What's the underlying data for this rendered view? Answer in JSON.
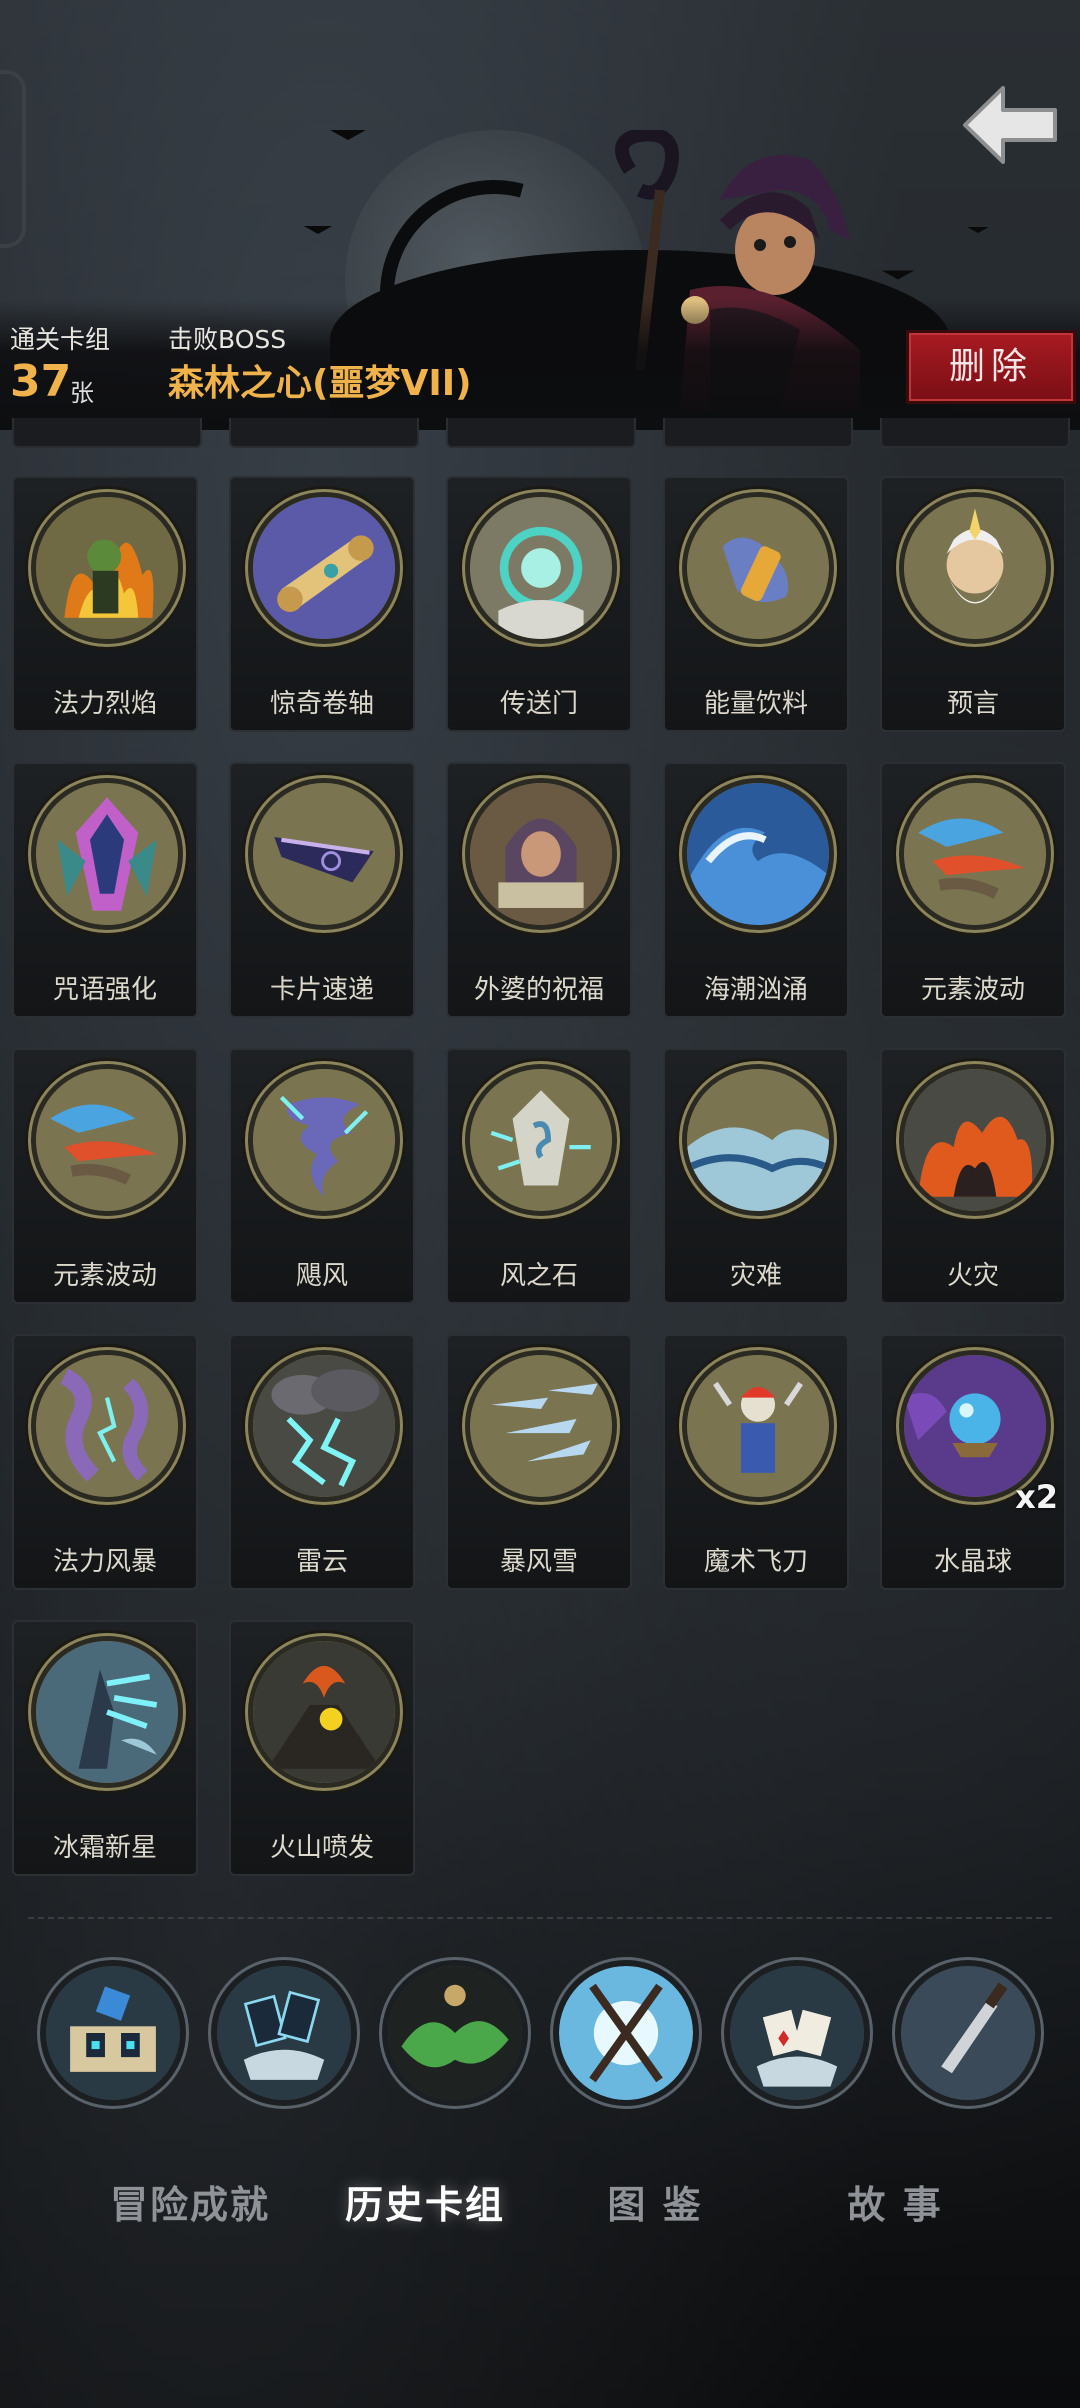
{
  "header": {
    "cleared_label": "通关卡组",
    "cleared_count": "37",
    "cleared_unit": "张",
    "boss_label": "击败BOSS",
    "boss_name": "森林之心(噩梦VII)",
    "delete_label": "删除"
  },
  "colors": {
    "accent_gold": "#f0b24a",
    "delete_red": "#a81a22",
    "card_bg": "#1a1c1f"
  },
  "cards": [
    {
      "name": "法力烈焰",
      "icon": "mana-flame-icon"
    },
    {
      "name": "惊奇卷轴",
      "icon": "scroll-icon"
    },
    {
      "name": "传送门",
      "icon": "portal-icon"
    },
    {
      "name": "能量饮料",
      "icon": "energy-drink-icon"
    },
    {
      "name": "预言",
      "icon": "prophecy-icon"
    },
    {
      "name": "咒语强化",
      "icon": "spell-boost-icon"
    },
    {
      "name": "卡片速递",
      "icon": "card-delivery-icon"
    },
    {
      "name": "外婆的祝福",
      "icon": "grandma-blessing-icon"
    },
    {
      "name": "海潮汹涌",
      "icon": "tide-icon"
    },
    {
      "name": "元素波动",
      "icon": "elemental-wave-icon"
    },
    {
      "name": "元素波动",
      "icon": "elemental-wave-icon"
    },
    {
      "name": "飓风",
      "icon": "hurricane-icon"
    },
    {
      "name": "风之石",
      "icon": "wind-stone-icon"
    },
    {
      "name": "灾难",
      "icon": "disaster-icon"
    },
    {
      "name": "火灾",
      "icon": "fire-icon"
    },
    {
      "name": "法力风暴",
      "icon": "mana-storm-icon"
    },
    {
      "name": "雷云",
      "icon": "thundercloud-icon"
    },
    {
      "name": "暴风雪",
      "icon": "blizzard-icon"
    },
    {
      "name": "魔术飞刀",
      "icon": "magic-knife-icon"
    },
    {
      "name": "水晶球",
      "icon": "crystal-ball-icon",
      "count": "x2"
    },
    {
      "name": "冰霜新星",
      "icon": "frost-nova-icon"
    },
    {
      "name": "火山喷发",
      "icon": "volcano-icon"
    }
  ],
  "relics": [
    {
      "icon": "spellbook-relic-icon"
    },
    {
      "icon": "card-hand-relic-icon"
    },
    {
      "icon": "green-spirit-relic-icon"
    },
    {
      "icon": "staff-relic-icon"
    },
    {
      "icon": "playing-cards-relic-icon"
    },
    {
      "icon": "dagger-relic-icon"
    }
  ],
  "tabs": [
    {
      "label": "冒险成就",
      "active": false
    },
    {
      "label": "历史卡组",
      "active": true
    },
    {
      "label": "图 鉴",
      "active": false
    },
    {
      "label": "故 事",
      "active": false
    }
  ]
}
